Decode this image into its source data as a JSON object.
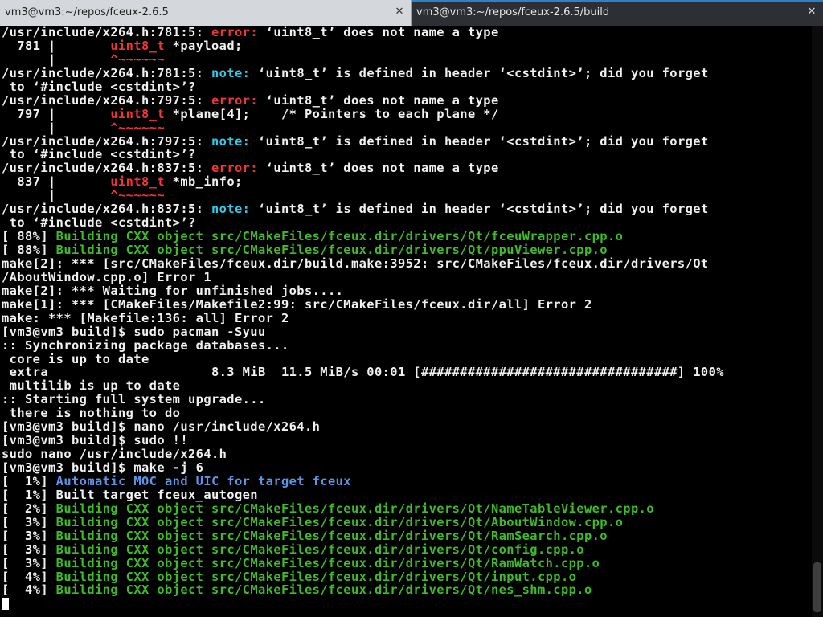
{
  "tabs": [
    {
      "title": "vm3@vm3:~/repos/fceux-2.6.5",
      "close": "✕"
    },
    {
      "title": "vm3@vm3:~/repos/fceux-2.6.5/build",
      "close": "✕"
    }
  ],
  "colors": {
    "error": "#ef3535",
    "note": "#33c8e8",
    "building": "#3ebb26",
    "automatic": "#5c95e6",
    "text": "#f0f0f0",
    "active_tab_accent": "#2f80c9"
  },
  "lines": [
    {
      "a": "/usr/include/x264.h:781:5: ",
      "b": "error:",
      "c": " ‘uint8_t’ does not name a type"
    },
    {
      "a": "  781 |       ",
      "b": "uint8_t",
      "c": " *payload;"
    },
    {
      "a": "      |       ",
      "b": "^~~~~~~",
      "c": ""
    },
    {
      "a": "/usr/include/x264.h:781:5: ",
      "b": "note:",
      "c": " ‘uint8_t’ is defined in header ‘<cstdint>’; did you forget"
    },
    {
      "a": " to ‘#include <cstdint>’?"
    },
    {
      "a": "/usr/include/x264.h:797:5: ",
      "b": "error:",
      "c": " ‘uint8_t’ does not name a type"
    },
    {
      "a": "  797 |       ",
      "b": "uint8_t",
      "c": " *plane[4];    /* Pointers to each plane */"
    },
    {
      "a": "      |       ",
      "b": "^~~~~~~",
      "c": ""
    },
    {
      "a": "/usr/include/x264.h:797:5: ",
      "b": "note:",
      "c": " ‘uint8_t’ is defined in header ‘<cstdint>’; did you forget"
    },
    {
      "a": " to ‘#include <cstdint>’?"
    },
    {
      "a": "/usr/include/x264.h:837:5: ",
      "b": "error:",
      "c": " ‘uint8_t’ does not name a type"
    },
    {
      "a": "  837 |       ",
      "b": "uint8_t",
      "c": " *mb_info;"
    },
    {
      "a": "      |       ",
      "b": "^~~~~~~",
      "c": ""
    },
    {
      "a": "/usr/include/x264.h:837:5: ",
      "b": "note:",
      "c": " ‘uint8_t’ is defined in header ‘<cstdint>’; did you forget"
    },
    {
      "a": " to ‘#include <cstdint>’?"
    },
    {
      "a": "[ 88%] ",
      "b": "Building CXX object src/CMakeFiles/fceux.dir/drivers/Qt/fceuWrapper.cpp.o"
    },
    {
      "a": "[ 88%] ",
      "b": "Building CXX object src/CMakeFiles/fceux.dir/drivers/Qt/ppuViewer.cpp.o"
    },
    {
      "a": "make[2]: *** [src/CMakeFiles/fceux.dir/build.make:3952: src/CMakeFiles/fceux.dir/drivers/Qt"
    },
    {
      "a": "/AboutWindow.cpp.o] Error 1"
    },
    {
      "a": "make[2]: *** Waiting for unfinished jobs...."
    },
    {
      "a": "make[1]: *** [CMakeFiles/Makefile2:99: src/CMakeFiles/fceux.dir/all] Error 2"
    },
    {
      "a": "make: *** [Makefile:136: all] Error 2"
    },
    {
      "a": "[vm3@vm3 build]$ sudo pacman -Syuu"
    },
    {
      "a": ":: Synchronizing package databases..."
    },
    {
      "a": " core is up to date"
    },
    {
      "a": " extra                     8.3 MiB  11.5 MiB/s 00:01 [#################################] 100%"
    },
    {
      "a": " multilib is up to date"
    },
    {
      "a": ":: Starting full system upgrade..."
    },
    {
      "a": " there is nothing to do"
    },
    {
      "a": "[vm3@vm3 build]$ nano /usr/include/x264.h"
    },
    {
      "a": "[vm3@vm3 build]$ sudo !!"
    },
    {
      "a": "sudo nano /usr/include/x264.h"
    },
    {
      "a": "[vm3@vm3 build]$ make -j 6"
    },
    {
      "a": "[  1%] ",
      "b": "Automatic MOC and UIC for target fceux"
    },
    {
      "a": "[  1%] Built target fceux_autogen"
    },
    {
      "a": "[  2%] ",
      "b": "Building CXX object src/CMakeFiles/fceux.dir/drivers/Qt/NameTableViewer.cpp.o"
    },
    {
      "a": "[  3%] ",
      "b": "Building CXX object src/CMakeFiles/fceux.dir/drivers/Qt/AboutWindow.cpp.o"
    },
    {
      "a": "[  3%] ",
      "b": "Building CXX object src/CMakeFiles/fceux.dir/drivers/Qt/RamSearch.cpp.o"
    },
    {
      "a": "[  3%] ",
      "b": "Building CXX object src/CMakeFiles/fceux.dir/drivers/Qt/config.cpp.o"
    },
    {
      "a": "[  3%] ",
      "b": "Building CXX object src/CMakeFiles/fceux.dir/drivers/Qt/RamWatch.cpp.o"
    },
    {
      "a": "[  4%] ",
      "b": "Building CXX object src/CMakeFiles/fceux.dir/drivers/Qt/input.cpp.o"
    },
    {
      "a": "[  4%] ",
      "b": "Building CXX object src/CMakeFiles/fceux.dir/drivers/Qt/nes_shm.cpp.o"
    }
  ]
}
